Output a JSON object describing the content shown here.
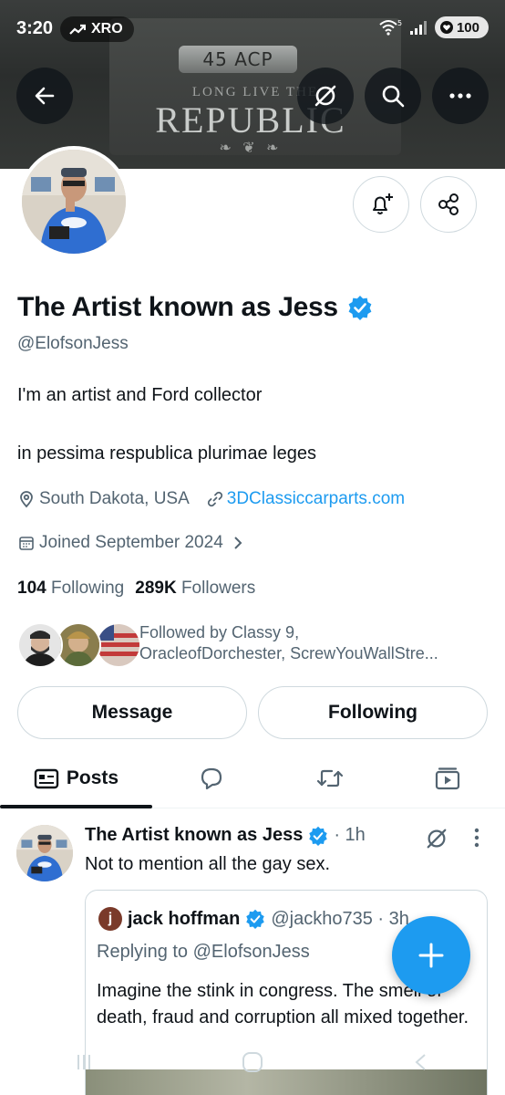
{
  "status_bar": {
    "time": "3:20",
    "ticker": "XRO",
    "battery": "100"
  },
  "banner": {
    "engraving_top": "45 ACP",
    "engraving_mid": "LONG LIVE THE",
    "engraving_big": "REPUBLIC"
  },
  "header_icons": {
    "back": "back-arrow-icon",
    "grok": "grok-icon",
    "search": "search-icon",
    "more": "more-icon"
  },
  "profile": {
    "display_name": "The Artist known as Jess",
    "handle": "@ElofsonJess",
    "bio_line1": "I'm an artist and Ford collector",
    "bio_line2": "in pessima respublica plurimae leges",
    "location": "South Dakota, USA",
    "website": "3DClassiccarparts.com",
    "joined": "Joined September 2024",
    "following_count": "104",
    "following_label": "Following",
    "followers_count": "289K",
    "followers_label": "Followers",
    "followed_by_line1": "Followed by Classy 9,",
    "followed_by_line2": "OracleofDorchester, ScrewYouWallStre..."
  },
  "actions": {
    "message_label": "Message",
    "following_label": "Following"
  },
  "tabs": [
    {
      "label": "Posts",
      "icon": "posts-icon"
    },
    {
      "label": "",
      "icon": "replies-icon"
    },
    {
      "label": "",
      "icon": "reposts-icon"
    },
    {
      "label": "",
      "icon": "media-icon"
    }
  ],
  "post": {
    "author": "The Artist known as Jess",
    "time": "· 1h",
    "text": "Not to mention all the gay sex.",
    "quote": {
      "avatar_letter": "j",
      "author": "jack hoffman",
      "handle": "@jackho735 · 3h",
      "replying_to": "Replying to @ElofsonJess",
      "text": "Imagine the stink in congress. The smell of death, fraud and corruption all mixed together."
    }
  },
  "colors": {
    "accent": "#1d9bf0",
    "text": "#0f1419",
    "muted": "#536471",
    "border": "#cfd9de"
  }
}
